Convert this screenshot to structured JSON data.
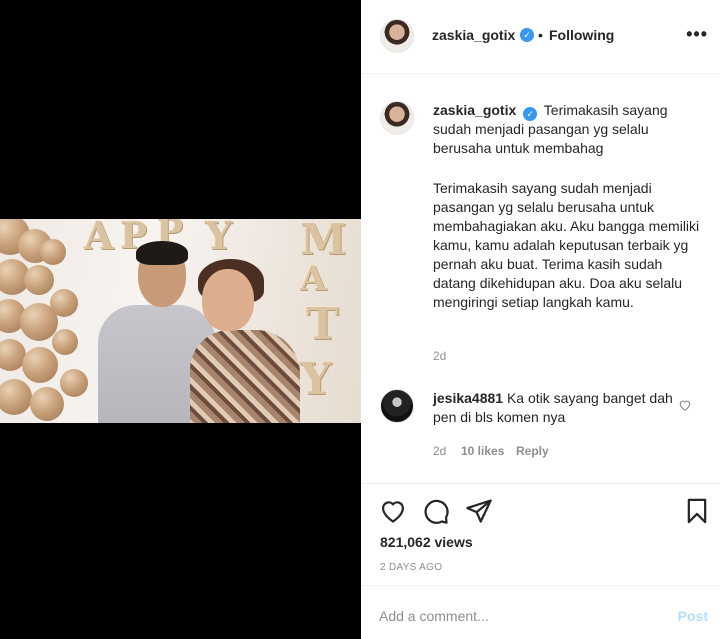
{
  "post": {
    "username": "zaskia_gotix",
    "separator": "•",
    "follow_status": "Following",
    "more_label": "•••"
  },
  "caption": {
    "username": "zaskia_gotix",
    "text_intro": "Terimakasih sayang sudah menjadi pasangan yg selalu berusaha untuk membahag",
    "text_body": "Terimakasih sayang sudah menjadi pasangan yg selalu berusaha untuk membahagiakan aku. Aku bangga memiliki kamu, kamu adalah keputusan terbaik yg pernah aku buat. Terima kasih sudah datang dikehidupan aku. Doa aku selalu mengiringi setiap langkah kamu.",
    "age": "2d"
  },
  "comment": {
    "username": "jesika4881",
    "text": "Ka otik sayang banget dah pen di bls komen nya",
    "age": "2d",
    "likes": "10 likes",
    "reply": "Reply"
  },
  "video": {
    "foil_letters": [
      "A",
      "P",
      "P",
      "Y",
      "M",
      "A",
      "T",
      "Y"
    ]
  },
  "stats": {
    "views": "821,062 views",
    "date": "2 DAYS AGO"
  },
  "add_comment": {
    "placeholder": "Add a comment...",
    "post_label": "Post"
  },
  "icons": {
    "like": "heart-icon",
    "comment": "comment-bubble-icon",
    "share": "paper-plane-icon",
    "save": "bookmark-icon",
    "verified": "verified-badge-icon",
    "more": "more-options-icon"
  },
  "colors": {
    "verified": "#3897f0",
    "post_disabled": "#b2dffc",
    "muted": "#8e8e8e"
  }
}
